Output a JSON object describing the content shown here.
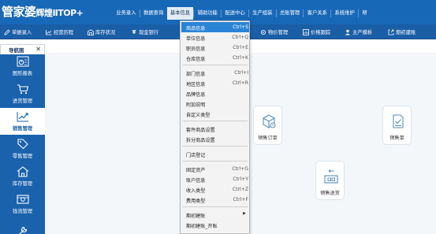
{
  "app": {
    "logo_main": "管家婆",
    "logo_sub": "辉煌ⅡTOP+"
  },
  "topmenu": {
    "items": [
      "业务录入",
      "数据查询",
      "基本信息",
      "辅助功能",
      "配送中心",
      "生产组装",
      "总账管理",
      "客户关系",
      "系统维护",
      "帮"
    ],
    "active_index": 2
  },
  "toolbar": {
    "items": [
      {
        "label": "单据录入",
        "icon": "edit-icon"
      },
      {
        "label": "经营历程",
        "icon": "trend-icon"
      },
      {
        "label": "库存状况",
        "icon": "warehouse-icon"
      },
      {
        "label": "现金银行",
        "icon": "yen-icon"
      },
      {
        "label": "物价管理",
        "icon": "gear-icon"
      },
      {
        "label": "价格跟踪",
        "icon": "chart-icon"
      },
      {
        "label": "主产模析",
        "icon": "user-icon"
      },
      {
        "label": "期初建账",
        "icon": "external-icon"
      }
    ]
  },
  "tabs": {
    "nav_label": "导航图",
    "close_glyph": "✕"
  },
  "sidebar": {
    "items": [
      {
        "label": "图形报表",
        "icon": "report-icon"
      },
      {
        "label": "进货管理",
        "icon": "cart-icon"
      },
      {
        "label": "销售管理",
        "icon": "sales-trend-icon"
      },
      {
        "label": "零售管理",
        "icon": "tag-icon"
      },
      {
        "label": "库存管理",
        "icon": "house-icon"
      },
      {
        "label": "钱流管理",
        "icon": "money-icon"
      },
      {
        "label": "",
        "icon": "wrench-icon"
      }
    ],
    "active_index": 2
  },
  "main": {
    "cards": [
      {
        "label": "销售订单",
        "icon": "order-box-icon"
      },
      {
        "label": "销售单",
        "icon": "sales-doc-icon"
      },
      {
        "label": "销售退货",
        "icon": "return-goods-icon"
      }
    ]
  },
  "dropdown": {
    "items": [
      {
        "label": "商品信息",
        "shortcut": "Ctrl+S",
        "selected": true
      },
      {
        "label": "单位信息",
        "shortcut": "Ctrl+Q"
      },
      {
        "label": "职员信息",
        "shortcut": "Ctrl+E"
      },
      {
        "label": "仓库信息",
        "shortcut": "Ctrl+K"
      },
      {
        "label": "部门信息",
        "shortcut": "Ctrl+I"
      },
      {
        "label": "地区信息",
        "shortcut": "Ctrl+R"
      },
      {
        "label": "品牌信息",
        "shortcut": ""
      },
      {
        "label": "附加说明",
        "shortcut": ""
      },
      {
        "label": "自定义类型",
        "shortcut": ""
      },
      {
        "label": "套件商品设置",
        "shortcut": ""
      },
      {
        "label": "拆分商品设置",
        "shortcut": ""
      },
      {
        "label": "门店登记",
        "shortcut": ""
      },
      {
        "label": "固定资产",
        "shortcut": "Ctrl+G"
      },
      {
        "label": "账户信息",
        "shortcut": "Ctrl+Y"
      },
      {
        "label": "收入类型",
        "shortcut": "Ctrl+Z"
      },
      {
        "label": "费用类型",
        "shortcut": "Ctrl+F"
      },
      {
        "label": "期初建账",
        "shortcut": "",
        "submenu": true
      },
      {
        "label": "期初建账_开账",
        "shortcut": ""
      }
    ]
  },
  "colors": {
    "header": "#1868b8",
    "toolbar": "#1a5ea6",
    "sidebar": "#1a62ac",
    "menu_selected": "#2a84d6",
    "main_bg": "#f4f7fa"
  }
}
